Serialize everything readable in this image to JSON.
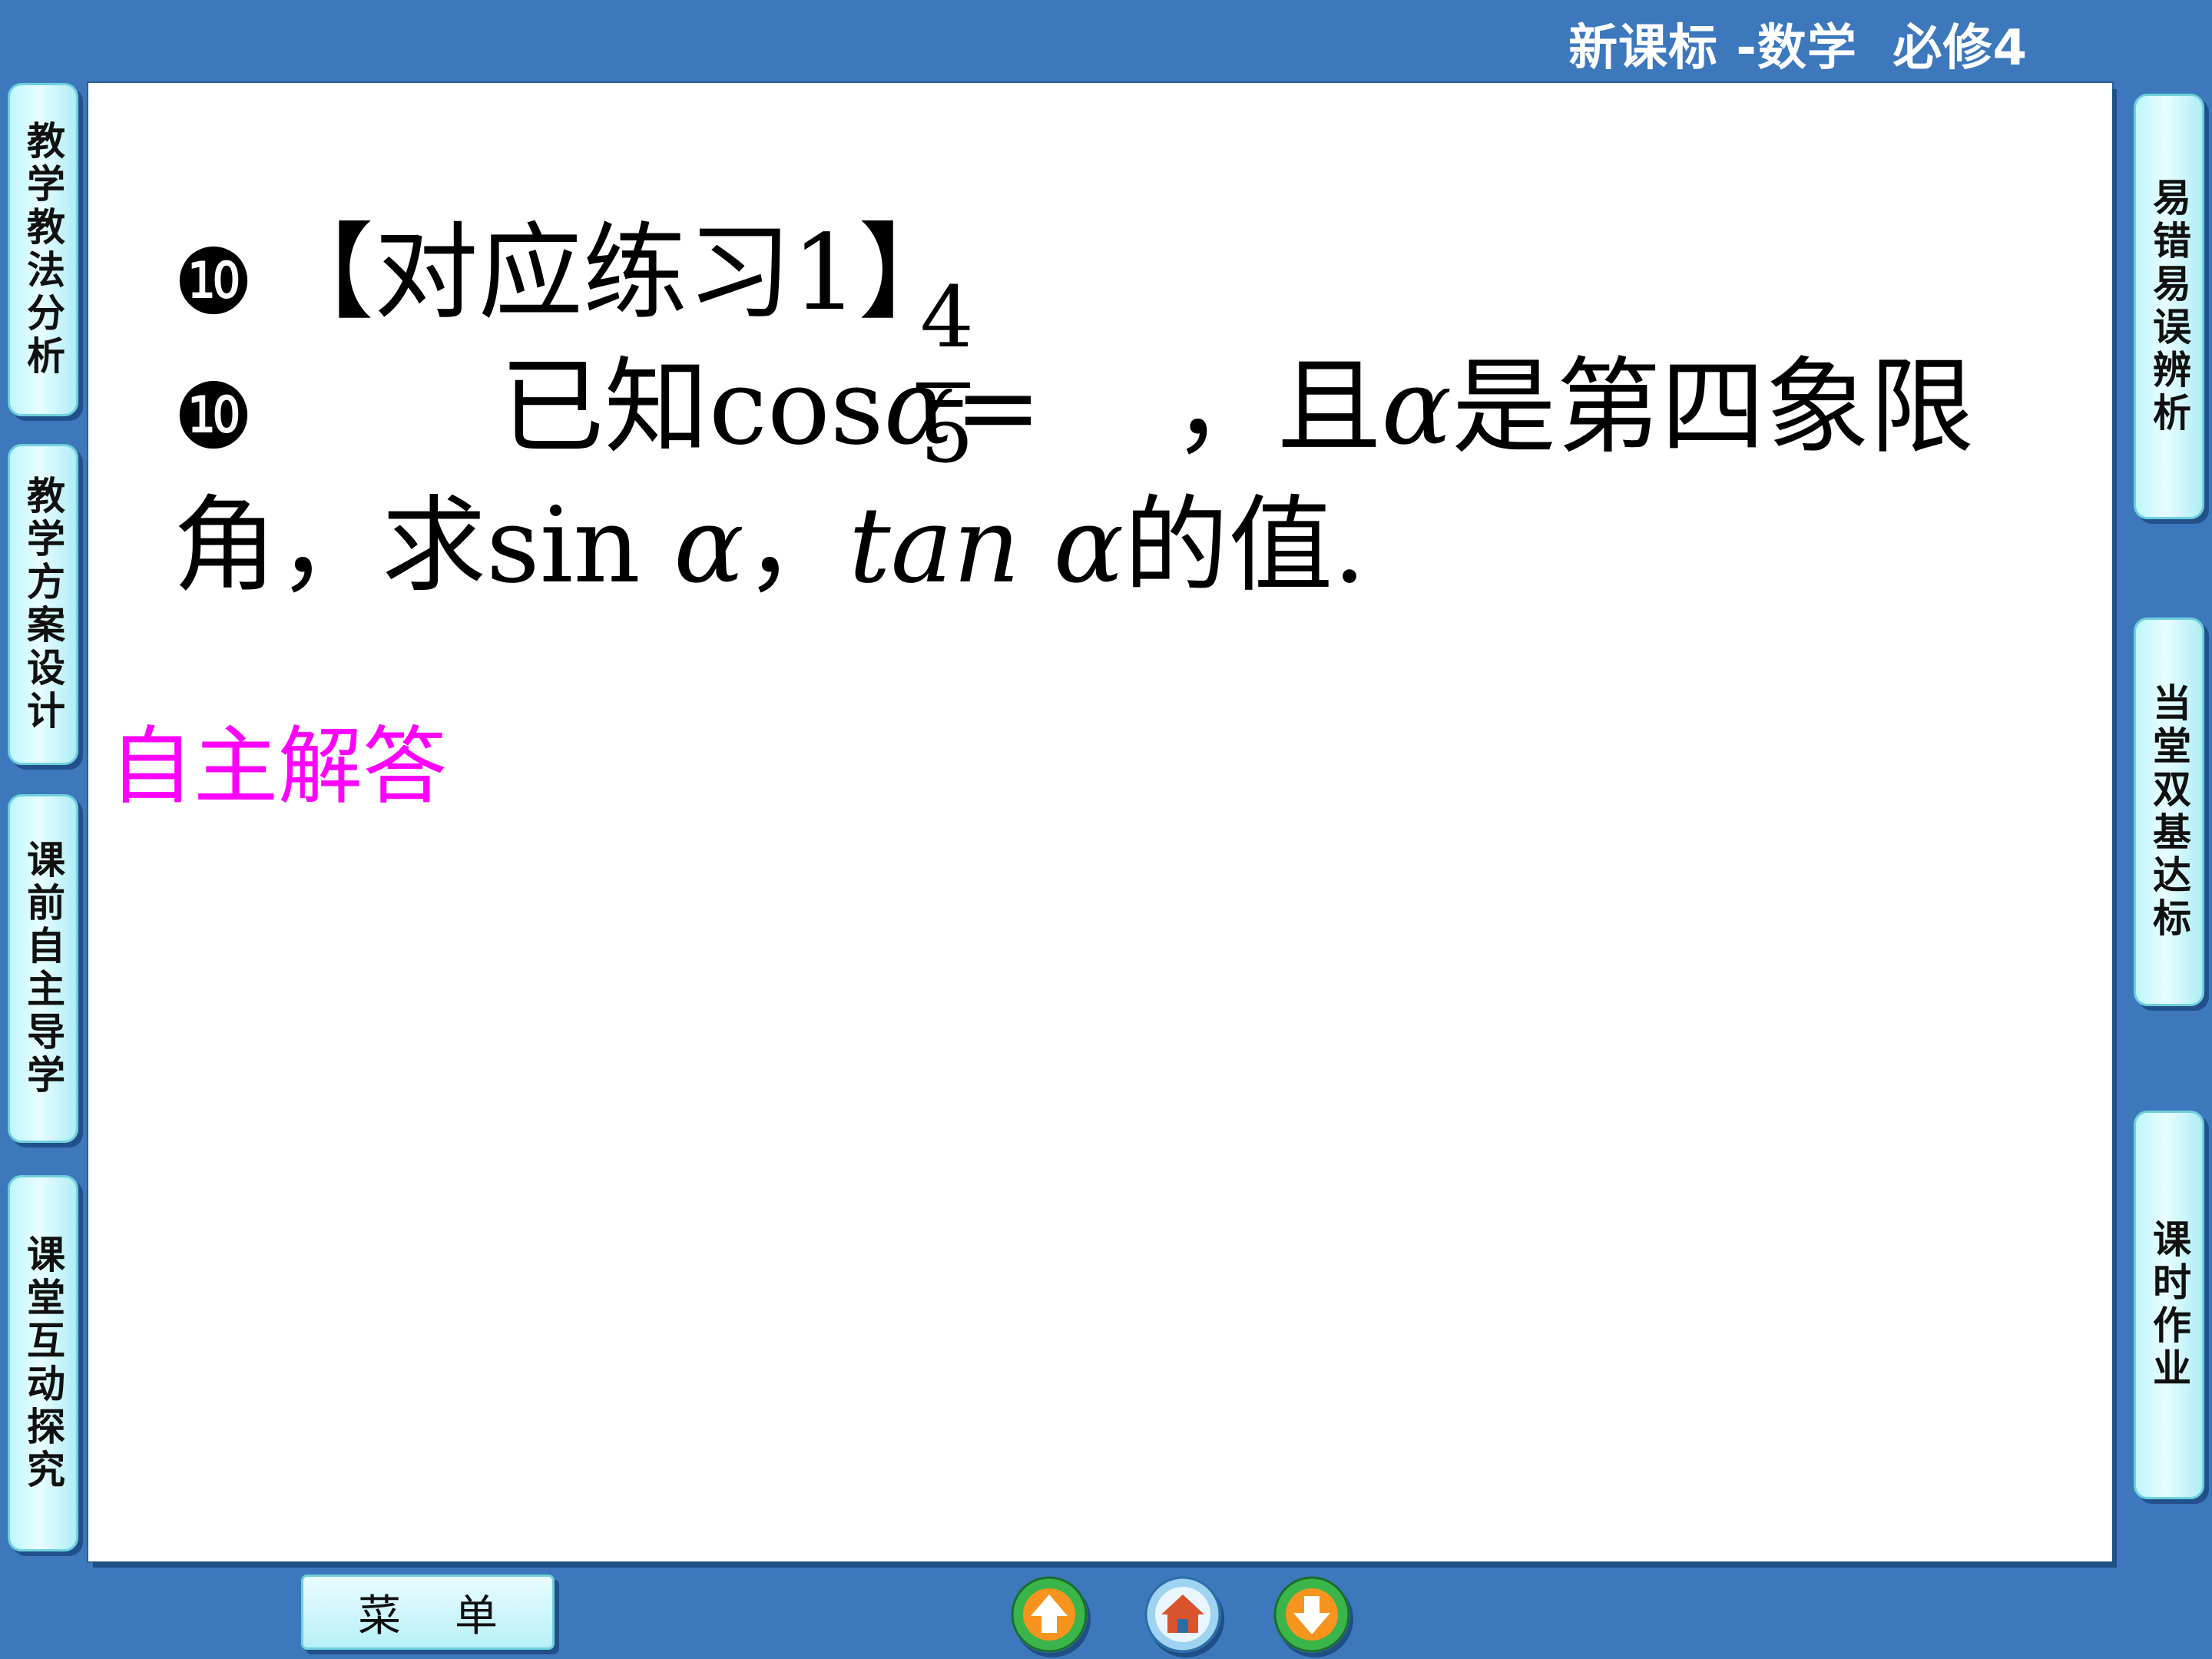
{
  "header": {
    "title": "新课标 -数学  必修4"
  },
  "left_nav": [
    {
      "label": "教学教法分析"
    },
    {
      "label": "教学方案设计"
    },
    {
      "label": "课前自主导学"
    },
    {
      "label": "课堂互动探究"
    }
  ],
  "right_nav": [
    {
      "label": "易错易误辨析"
    },
    {
      "label": "当堂双基达标"
    },
    {
      "label": "课时作业"
    }
  ],
  "content": {
    "bullet": "❿",
    "heading": "【对应练习1】",
    "line2_prefix": "已知cos",
    "alpha": "α",
    "eq": "=",
    "frac_num": "4",
    "frac_den": "5",
    "line2_mid": "，且",
    "line2_suffix": "是第四象限",
    "line3_a": "角，求sin ",
    "line3_b": "，",
    "line3_tan": "tan ",
    "line3_c": "的值.",
    "answer_label": "自主解答"
  },
  "bottom": {
    "menu_label": "菜单",
    "prev_icon": "up-arrow-icon",
    "home_icon": "home-icon",
    "next_icon": "down-arrow-icon"
  }
}
